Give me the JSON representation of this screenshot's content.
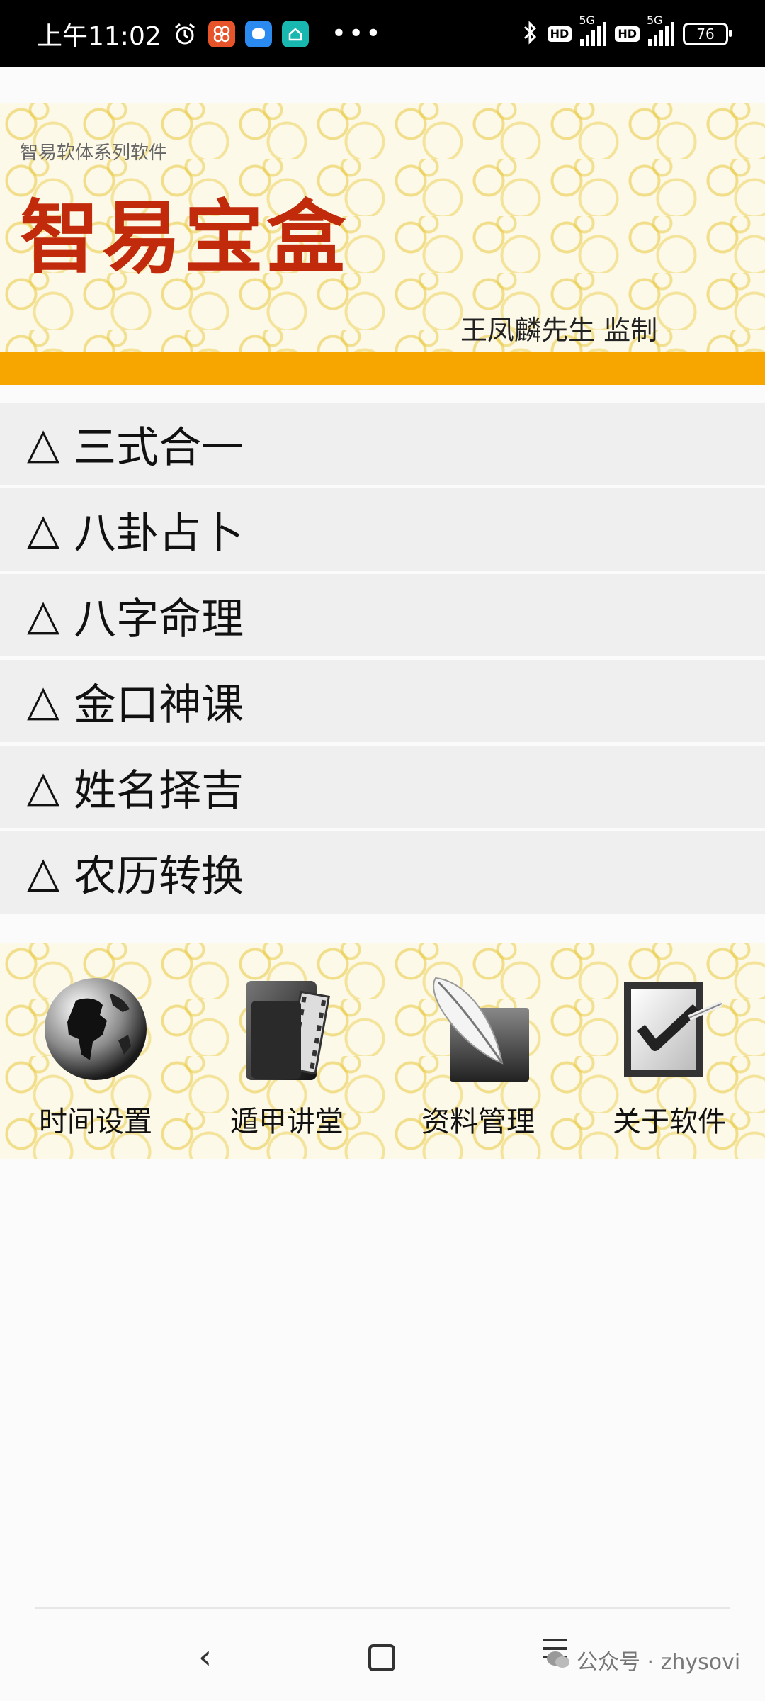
{
  "status_bar": {
    "time": "上午11:02",
    "net_hd_1": "HD",
    "net_5g_1": "5G",
    "net_hd_2": "HD",
    "net_5g_2": "5G",
    "battery": "76"
  },
  "header": {
    "subtitle": "智易软体系列软件",
    "title": "智易宝盒",
    "credit": "王凤麟先生 监制"
  },
  "menu": {
    "items": [
      {
        "label": "三式合一"
      },
      {
        "label": "八卦占卜"
      },
      {
        "label": "八字命理"
      },
      {
        "label": "金口神课"
      },
      {
        "label": "姓名择吉"
      },
      {
        "label": "农历转换"
      }
    ],
    "marker": "△"
  },
  "tiles": [
    {
      "label": "时间设置",
      "icon": "globe-icon"
    },
    {
      "label": "遁甲讲堂",
      "icon": "film-folder-icon"
    },
    {
      "label": "资料管理",
      "icon": "feather-icon"
    },
    {
      "label": "关于软件",
      "icon": "checkbox-icon"
    }
  ],
  "watermark": {
    "text": "公众号 · zhysovi"
  },
  "colors": {
    "title_red": "#c12a0a",
    "accent_orange": "#f7a600",
    "menu_bg": "#efefef"
  }
}
